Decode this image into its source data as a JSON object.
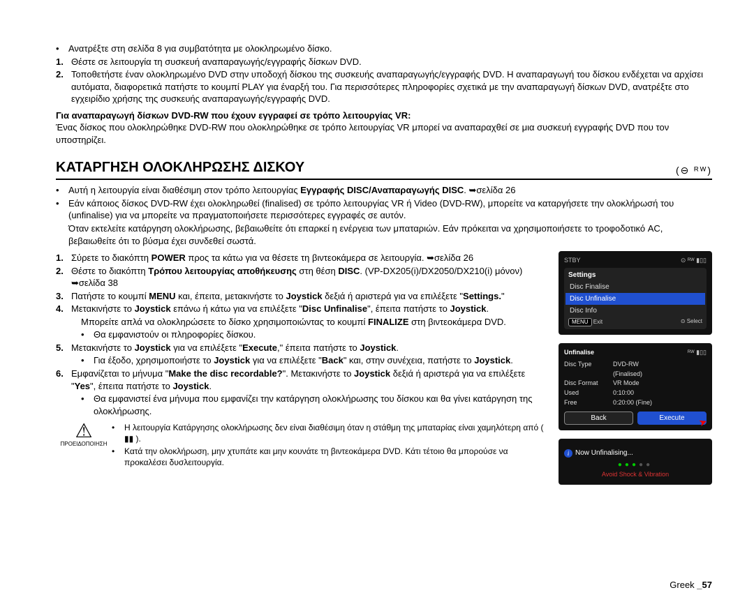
{
  "intro": {
    "bullet": "Ανατρέξτε στη σελίδα 8 για συμβατότητα με ολοκληρωμένο δίσκο.",
    "step1": "Θέστε σε λειτουργία τη συσκευή αναπαραγωγής/εγγραφής δίσκων DVD.",
    "step2": "Τοποθετήστε έναν ολοκληρωμένο DVD στην υποδοχή δίσκου της συσκευής αναπαραγωγής/εγγραφής DVD. Η αναπαραγωγή του δίσκου ενδέχεται να αρχίσει αυτόματα, διαφορετικά πατήστε το κουμπί PLAY για έναρξή του. Για περισσότερες πληροφορίες σχετικά με την αναπαραγωγή δίσκων DVD, ανατρέξτε στο εγχειρίδιο χρήσης της συσκευής αναπαραγωγής/εγγραφής DVD.",
    "vr_head": "Για αναπαραγωγή δίσκων DVD-RW που έχουν εγγραφεί σε τρόπο λειτουργίας VR:",
    "vr_body": "Ένας δίσκος που ολοκληρώθηκε DVD-RW που ολοκληρώθηκε σε τρόπο λειτουργίας VR μπορεί να αναπαραχθεί σε μια συσκευή εγγραφής DVD που τον υποστηρίζει."
  },
  "section_title": "ΚΑΤΑΡΓΗΣΗ ΟΛΟΚΛΗΡΩΣΗΣ ΔΙΣΚΟΥ",
  "section_icons": "(⊖ ᴿᵂ)",
  "body": {
    "b1a": "Αυτή η λειτουργία είναι διαθέσιμη στον τρόπο λειτουργίας ",
    "b1b": "Εγγραφής DISC/Αναπαραγωγής DISC",
    "b1c": ". ➥σελίδα 26",
    "b2": "Εάν κάποιος δίσκος DVD-RW έχει ολοκληρωθεί (finalised) σε τρόπο λειτουργίας VR ή Video (DVD-RW), μπορείτε να καταργήσετε την ολοκλήρωσή του (unfinalise) για να μπορείτε να πραγματοποιήσετε περισσότερες εγγραφές σε αυτόν.",
    "b2i": "Όταν εκτελείτε κατάργηση ολοκλήρωσης, βεβαιωθείτε ότι επαρκεί η ενέργεια των μπαταριών. Εάν πρόκειται να χρησιμοποιήσετε το τροφοδοτικό AC, βεβαιωθείτε ότι το βύσμα έχει συνδεθεί σωστά.",
    "s1a": "Σύρετε το διακόπτη ",
    "s1b": "POWER",
    "s1c": " προς τα κάτω για να θέσετε τη βιντεοκάμερα σε λειτουργία. ➥σελίδα 26",
    "s2a": "Θέστε το διακόπτη ",
    "s2b": "Τρόπου λειτουργίας αποθήκευσης",
    "s2c": " στη θέση ",
    "s2d": "DISC",
    "s2e": ". (VP-DX205(i)/DX2050/DX210(i) μόνον) ➥σελίδα 38",
    "s3a": "Πατήστε το κουμπί ",
    "s3b": "MENU",
    "s3c": " και, έπειτα, μετακινήστε το ",
    "s3d": "Joystick",
    "s3e": " δεξιά ή αριστερά για να επιλέξετε \"",
    "s3f": "Settings.",
    "s3g": "\"",
    "s4a": "Μετακινήστε το ",
    "s4b": "Joystick",
    "s4c": " επάνω ή κάτω για να επιλέξετε \"",
    "s4d": "Disc Unfinalise",
    "s4e": "\", έπειτα πατήστε το ",
    "s4f": "Joystick",
    "s4g": ".",
    "s4i1a": "Μπορείτε απλά να ολοκληρώσετε το δίσκο χρησιμοποιώντας το κουμπί ",
    "s4i1b": "FINALIZE",
    "s4i1c": " στη βιντεοκάμερα DVD.",
    "s4i2": "Θα εμφανιστούν οι πληροφορίες δίσκου.",
    "s5a": "Μετακινήστε το ",
    "s5b": "Joystick",
    "s5c": " για να επιλέξετε \"",
    "s5d": "Execute",
    "s5e": ",\" έπειτα πατήστε το ",
    "s5f": "Joystick",
    "s5g": ".",
    "s5ia": "Για έξοδο, χρησιμοποιήστε το ",
    "s5ib": "Joystick",
    "s5ic": " για να επιλέξετε \"",
    "s5id": "Back",
    "s5ie": "\" και, στην συνέχεια, πατήστε το ",
    "s5if": "Joystick",
    "s5ig": ".",
    "s6a": "Εμφανίζεται το μήνυμα \"",
    "s6b": "Make the disc recordable?",
    "s6c": "\". Μετακινήστε το ",
    "s6d": "Joystick",
    "s6e": " δεξιά ή αριστερά για να επιλέξετε \"",
    "s6f": "Yes",
    "s6g": "\", έπειτα πατήστε το ",
    "s6h": "Joystick",
    "s6i": ".",
    "s6i1": "Θα εμφανιστεί ένα μήνυμα που εμφανίζει την κατάργηση ολοκλήρωσης του δίσκου και θα γίνει κατάργηση της ολοκλήρωσης."
  },
  "caution_label": "ΠΡΟΕΙΔΟΠΟΙΗΣΗ",
  "caution": {
    "c1": "Η λειτουργία Κατάργησης ολοκλήρωσης δεν είναι διαθέσιμη όταν η στάθμη της μπαταρίας είναι χαμηλότερη από ( ▮▮ ).",
    "c2": "Κατά την ολοκλήρωση, μην χτυπάτε και μην κουνάτε τη βιντεοκάμερα DVD. Κάτι τέτοιο θα μπορούσε να προκαλέσει δυσλειτουργία."
  },
  "cam1": {
    "top_left": "STBY",
    "top_right": "⊙ ᴿᵂ ▮▯▯",
    "settings": "Settings",
    "items": [
      "Disc Finalise",
      "Disc Unfinalise",
      "Disc Info"
    ],
    "hl_index": 1,
    "foot_left": "MENU",
    "foot_left2": "Exit",
    "foot_right": "⊙ Select"
  },
  "cam2": {
    "title": "Unfinalise",
    "top_icons": "ᴿᵂ ▮▯▯",
    "rows": [
      {
        "label": "Disc Type",
        "val": "DVD-RW"
      },
      {
        "label": "",
        "val": "(Finalised)"
      },
      {
        "label": "Disc Format",
        "val": "VR Mode"
      },
      {
        "label": "Used",
        "val": "0:10:00"
      },
      {
        "label": "Free",
        "val": "0:20:00 (Fine)"
      }
    ],
    "back": "Back",
    "execute": "Execute"
  },
  "cam3": {
    "now": "Now Unfinalising...",
    "warn": "Avoid Shock & Vibration"
  },
  "footer": {
    "lang": "Greek ",
    "page": "_57"
  }
}
